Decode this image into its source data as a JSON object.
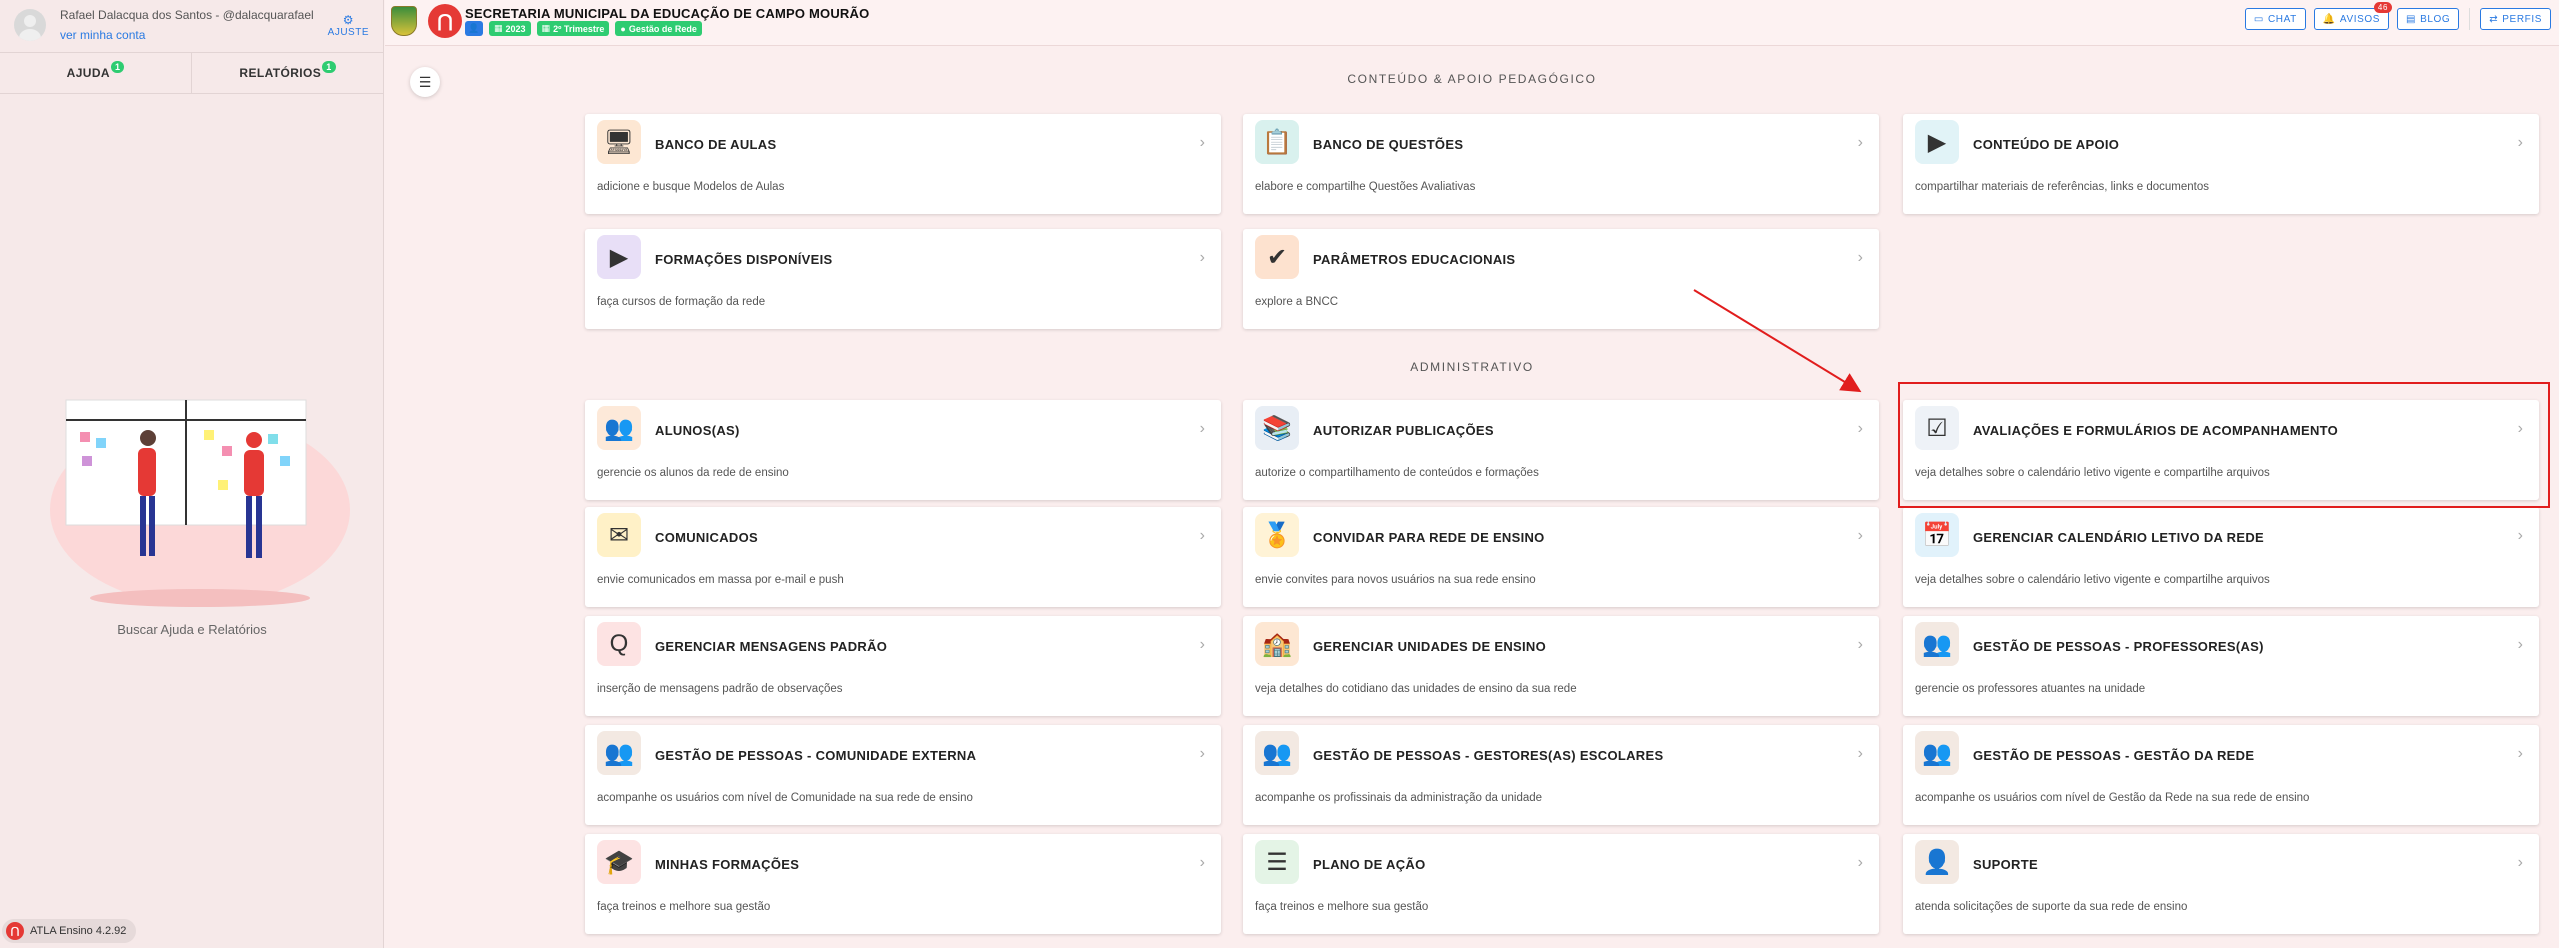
{
  "user": {
    "name": "Rafael Dalacqua dos Santos - @dalacquarafael",
    "link": "ver minha conta",
    "ajuste": "AJUSTE"
  },
  "sidebar": {
    "tabs": [
      {
        "label": "AJUDA",
        "count": "1"
      },
      {
        "label": "RELATÓRIOS",
        "count": "1"
      }
    ],
    "caption": "Buscar Ajuda e Relatórios",
    "version": "ATLA Ensino 4.2.92"
  },
  "header": {
    "title": "SECRETARIA MUNICIPAL DA EDUCAÇÃO DE CAMPO MOURÃO",
    "tags": [
      "2023",
      "2º Trimestre",
      "Gestão de Rede"
    ],
    "buttons": [
      {
        "label": "CHAT",
        "icon": "chat-icon"
      },
      {
        "label": "AVISOS",
        "icon": "bell-icon",
        "badge": "46"
      },
      {
        "label": "BLOG",
        "icon": "blog-icon"
      },
      {
        "label": "PERFIS",
        "icon": "swap-icon"
      }
    ]
  },
  "sections": {
    "pedagogico": "CONTEÚDO & APOIO PEDAGÓGICO",
    "administrativo": "ADMINISTRATIVO"
  },
  "cards_pedagogico": [
    {
      "title": "BANCO DE AULAS",
      "desc": "adicione e busque Modelos de Aulas",
      "icon": "lesson-bank-icon"
    },
    {
      "title": "BANCO DE QUESTÕES",
      "desc": "elabore e compartilhe Questões Avaliativas",
      "icon": "question-bank-icon"
    },
    {
      "title": "CONTEÚDO DE APOIO",
      "desc": "compartilhar materiais de referências, links e documentos",
      "icon": "support-content-icon"
    },
    {
      "title": "FORMAÇÕES DISPONÍVEIS",
      "desc": "faça cursos de formação da rede",
      "icon": "training-icon"
    },
    {
      "title": "PARÂMETROS EDUCACIONAIS",
      "desc": "explore a BNCC",
      "icon": "parameters-icon"
    }
  ],
  "cards_admin": [
    {
      "title": "ALUNOS(AS)",
      "desc": "gerencie os alunos da rede de ensino",
      "icon": "students-icon"
    },
    {
      "title": "AUTORIZAR PUBLICAÇÕES",
      "desc": "autorize o compartilhamento de conteúdos e formações",
      "icon": "books-icon"
    },
    {
      "title": "AVALIAÇÕES E FORMULÁRIOS DE ACOMPANHAMENTO",
      "desc": "veja detalhes sobre o calendário letivo vigente e compartilhe arquivos",
      "icon": "checklist-icon"
    },
    {
      "title": "COMUNICADOS",
      "desc": "envie comunicados em massa por e-mail e push",
      "icon": "email-icon"
    },
    {
      "title": "CONVIDAR PARA REDE DE ENSINO",
      "desc": "envie convites para novos usuários na sua rede ensino",
      "icon": "medal-icon"
    },
    {
      "title": "GERENCIAR CALENDÁRIO LETIVO DA REDE",
      "desc": "veja detalhes sobre o calendário letivo vigente e compartilhe arquivos",
      "icon": "calendar-icon"
    },
    {
      "title": "GERENCIAR MENSAGENS PADRÃO",
      "desc": "inserção de mensagens padrão de observações",
      "icon": "qa-icon"
    },
    {
      "title": "GERENCIAR UNIDADES DE ENSINO",
      "desc": "veja detalhes do cotidiano das unidades de ensino da sua rede",
      "icon": "school-icon"
    },
    {
      "title": "GESTÃO DE PESSOAS - PROFESSORES(AS)",
      "desc": "gerencie os professores atuantes na unidade",
      "icon": "teachers-icon"
    },
    {
      "title": "GESTÃO DE PESSOAS - COMUNIDADE EXTERNA",
      "desc": "acompanhe os usuários com nível de Comunidade na sua rede de ensino",
      "icon": "community-icon"
    },
    {
      "title": "GESTÃO DE PESSOAS - GESTORES(AS) ESCOLARES",
      "desc": "acompanhe os profissinais da administração da unidade",
      "icon": "managers-icon"
    },
    {
      "title": "GESTÃO DE PESSOAS - GESTÃO DA REDE",
      "desc": "acompanhe os usuários com nível de Gestão da Rede na sua rede de ensino",
      "icon": "network-managers-icon"
    },
    {
      "title": "MINHAS FORMAÇÕES",
      "desc": "faça treinos e melhore sua gestão",
      "icon": "certificate-icon"
    },
    {
      "title": "PLANO DE AÇÃO",
      "desc": "faça treinos e melhore sua gestão",
      "icon": "action-plan-icon"
    },
    {
      "title": "SUPORTE",
      "desc": "atenda solicitações de suporte da sua rede de ensino",
      "icon": "support-icon"
    }
  ],
  "colors": {
    "accent": "#2a7ae2",
    "brand": "#e53935",
    "tag": "#2ecc71",
    "highlight": "#e11d1d",
    "background": "#fbeeee"
  }
}
